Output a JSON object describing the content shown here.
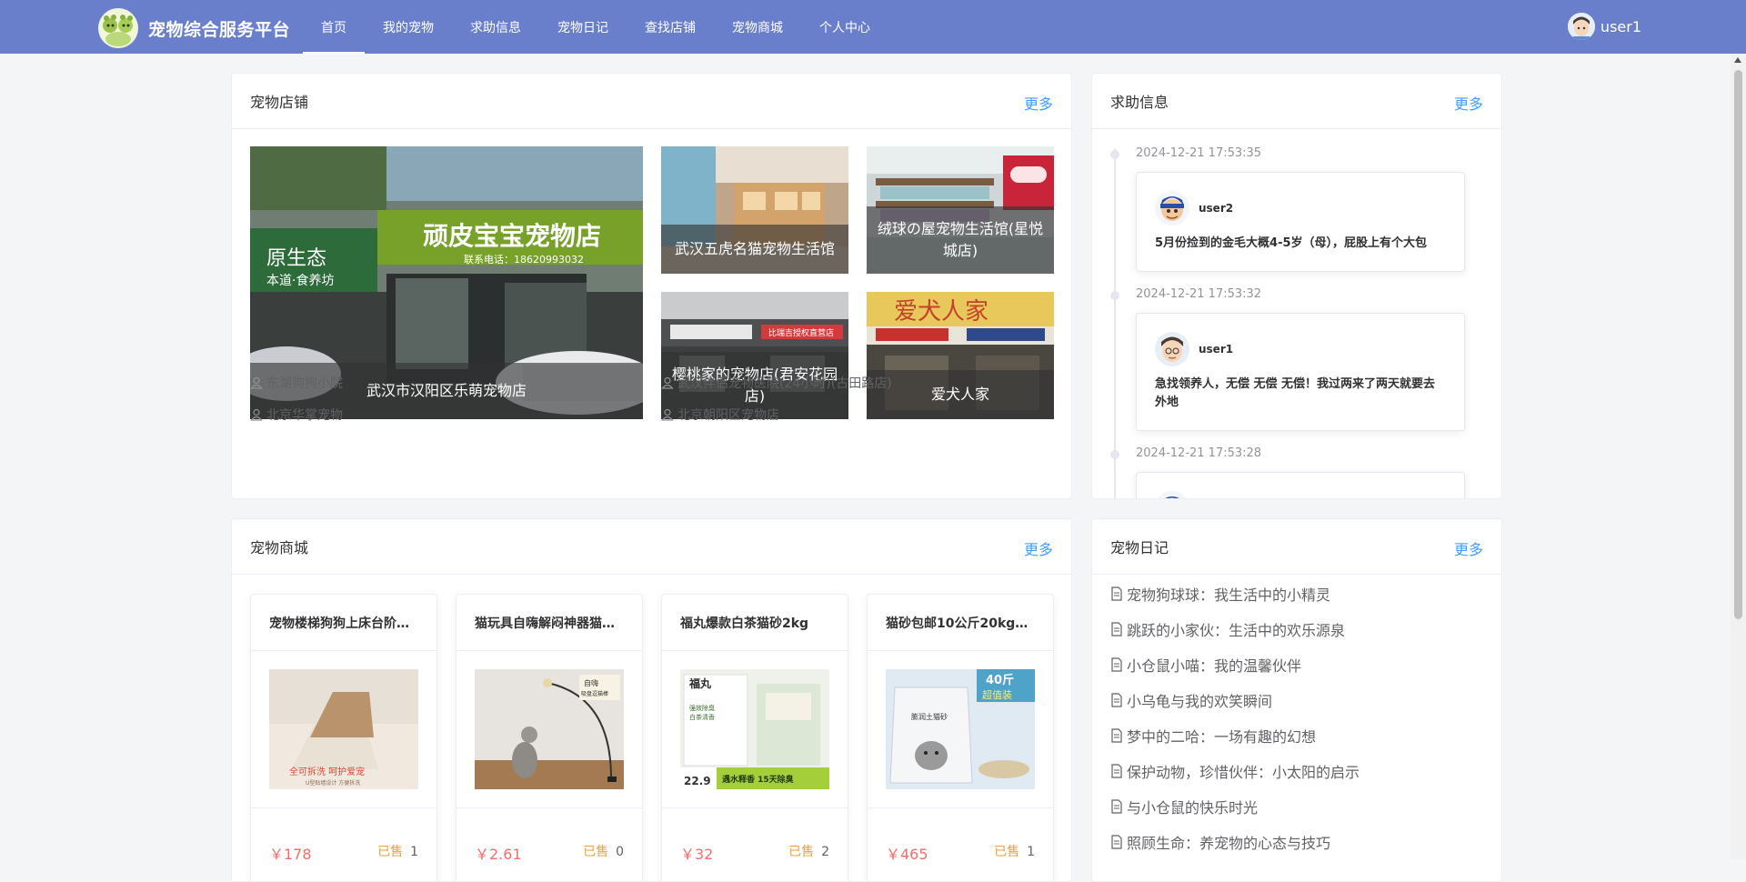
{
  "header": {
    "logo_text": "宠物综合服务平台",
    "nav": [
      "首页",
      "我的宠物",
      "求助信息",
      "宠物日记",
      "查找店铺",
      "宠物商城",
      "个人中心"
    ],
    "active_nav": "首页",
    "username": "user1",
    "colors": {
      "bar": "#6a7fcb",
      "text": "#ffffff"
    }
  },
  "shops": {
    "title": "宠物店铺",
    "more": "更多",
    "featured": [
      {
        "name": "武汉市汉阳区乐萌宠物店"
      },
      {
        "name": "武汉五虎名猫宠物生活馆"
      },
      {
        "name": "绒球の屋宠物生活馆(星悦城店)"
      },
      {
        "name": "樱桃家的宠物店(君安花园店)"
      },
      {
        "name": "爱犬人家"
      }
    ],
    "list": [
      "东湖狗狗小院",
      "武汉伴侣宠物医院(24小时)(古田路店)",
      "北京华掌宠物",
      "北京朝阳区宠物店"
    ]
  },
  "help": {
    "title": "求助信息",
    "more": "更多",
    "items": [
      {
        "time": "2024-12-21 17:53:35",
        "user": "user2",
        "text": "5月份捡到的金毛大概4-5岁（母），屁股上有个大包"
      },
      {
        "time": "2024-12-21 17:53:32",
        "user": "user1",
        "text": "急找领养人，无偿 无偿 无偿！我过两来了两天就要去外地"
      },
      {
        "time": "2024-12-21 17:53:28",
        "user": "",
        "text": ""
      }
    ]
  },
  "mall": {
    "title": "宠物商城",
    "more": "更多",
    "sold_label": "已售",
    "products": [
      {
        "name": "宠物楼梯狗狗上床台阶斜坡",
        "price": "￥178",
        "sold": "1"
      },
      {
        "name": "猫玩具自嗨解闷神器猫咪逗猫棒",
        "price": "￥2.61",
        "sold": "0"
      },
      {
        "name": "福丸爆款白茶猫砂2kg",
        "price": "￥32",
        "sold": "2"
      },
      {
        "name": "猫砂包邮10公斤20kg40斤膨润土",
        "price": "￥465",
        "sold": "1"
      }
    ],
    "product_images": {
      "p1_caption": "全可拆洗 呵护爱宠",
      "p1_sub": "U型贴墙设计 方便拆洗",
      "p2_tag": "自嗨",
      "p2_tag2": "吸盘逗猫棒",
      "p3_brand": "福丸",
      "p3_lines": [
        "强效除臭",
        "白茶清香"
      ],
      "p3_badge": "22.9",
      "p3_bottom": "遇水释香 15天除臭",
      "p4_badge": "40斤",
      "p4_badge2": "超值装",
      "p4_bag": "膨润土猫砂"
    }
  },
  "diary": {
    "title": "宠物日记",
    "more": "更多",
    "items": [
      "宠物狗球球：我生活中的小精灵",
      "跳跃的小家伙：生活中的欢乐源泉",
      "小仓鼠小喵：我的温馨伙伴",
      "小乌龟与我的欢笑瞬间",
      "梦中的二哈：一场有趣的幻想",
      "保护动物，珍惜伙伴：小太阳的启示",
      "与小仓鼠的快乐时光",
      "照顾生命：养宠物的心态与技巧"
    ]
  },
  "shop_photo_text": {
    "main_sign": "顽皮宝宝宠物店",
    "main_phone": "联系电话：18620993032",
    "main_side": "原生态",
    "main_side2": "本道·食养坊",
    "tile4_sign": "比瑞吉授权直营店",
    "tile5_sign": "爱犬人家"
  },
  "colors": {
    "accent": "#409eff",
    "price": "#f56c6c",
    "sold": "#e6a23c"
  }
}
